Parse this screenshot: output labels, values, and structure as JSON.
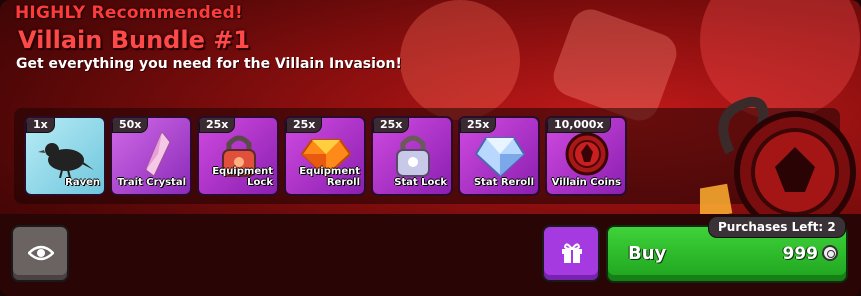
{
  "header": {
    "tagline": "HIGHLY Recommended!",
    "title": "Villain Bundle #1",
    "subtitle": "Get everything you need for the Villain Invasion!"
  },
  "items": [
    {
      "qty": "1x",
      "name": "Raven",
      "icon": "raven-icon",
      "color": "#8fd6e8"
    },
    {
      "qty": "50x",
      "name": "Trait Crystal",
      "icon": "crystal-icon",
      "color": "#b14ad8"
    },
    {
      "qty": "25x",
      "name": "Equipment Lock",
      "icon": "padlock-icon",
      "color": "#b13ad0"
    },
    {
      "qty": "25x",
      "name": "Equipment Reroll",
      "icon": "gem-icon",
      "color": "#b13ad0"
    },
    {
      "qty": "25x",
      "name": "Stat Lock",
      "icon": "padlock-icon",
      "color": "#b13ad0"
    },
    {
      "qty": "25x",
      "name": "Stat Reroll",
      "icon": "diamond-icon",
      "color": "#b13ad0"
    },
    {
      "qty": "10,000x",
      "name": "Villain Coins",
      "icon": "villain-coin-icon",
      "color": "#b13ad0"
    }
  ],
  "purchases_left": "Purchases Left: 2",
  "buy": {
    "label": "Buy",
    "price": "999"
  },
  "colors": {
    "accent": "#ff4848",
    "buy_green": "#2fc02a",
    "gift_purple": "#a43ae0"
  }
}
